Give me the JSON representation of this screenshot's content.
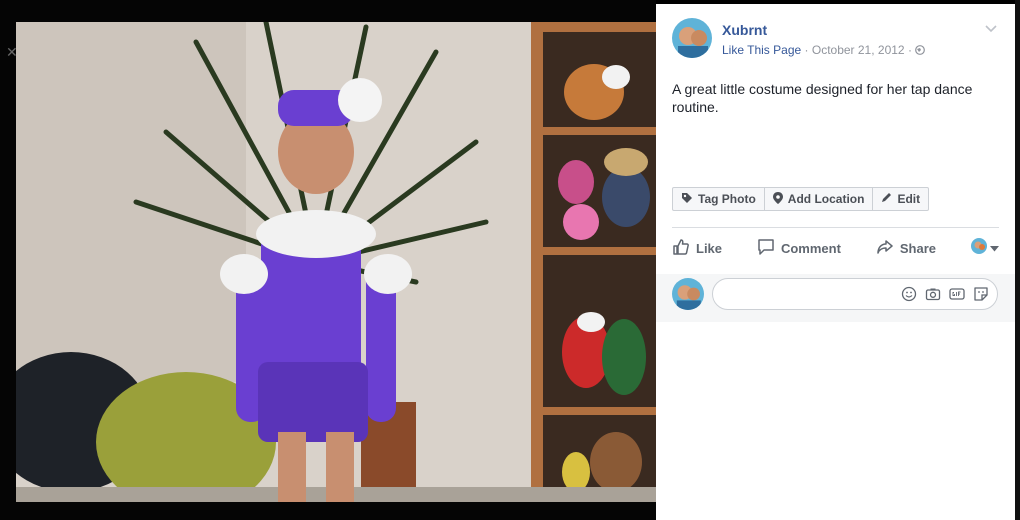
{
  "post": {
    "author": "Xubrnt",
    "like_page": "Like This Page",
    "separator": "·",
    "date": "October 21, 2012",
    "privacy_icon": "globe-icon",
    "caption": "A great little costume designed for her tap dance routine."
  },
  "photo_actions": {
    "tag": "Tag Photo",
    "location": "Add Location",
    "edit": "Edit"
  },
  "actions": {
    "like": "Like",
    "comment": "Comment",
    "share": "Share"
  },
  "comment_box": {
    "icons": [
      "emoji-icon",
      "camera-icon",
      "gif-icon",
      "sticker-icon"
    ]
  },
  "colors": {
    "link": "#365899",
    "costume": "#6a3fd1",
    "wall": "#ddd5cd"
  }
}
